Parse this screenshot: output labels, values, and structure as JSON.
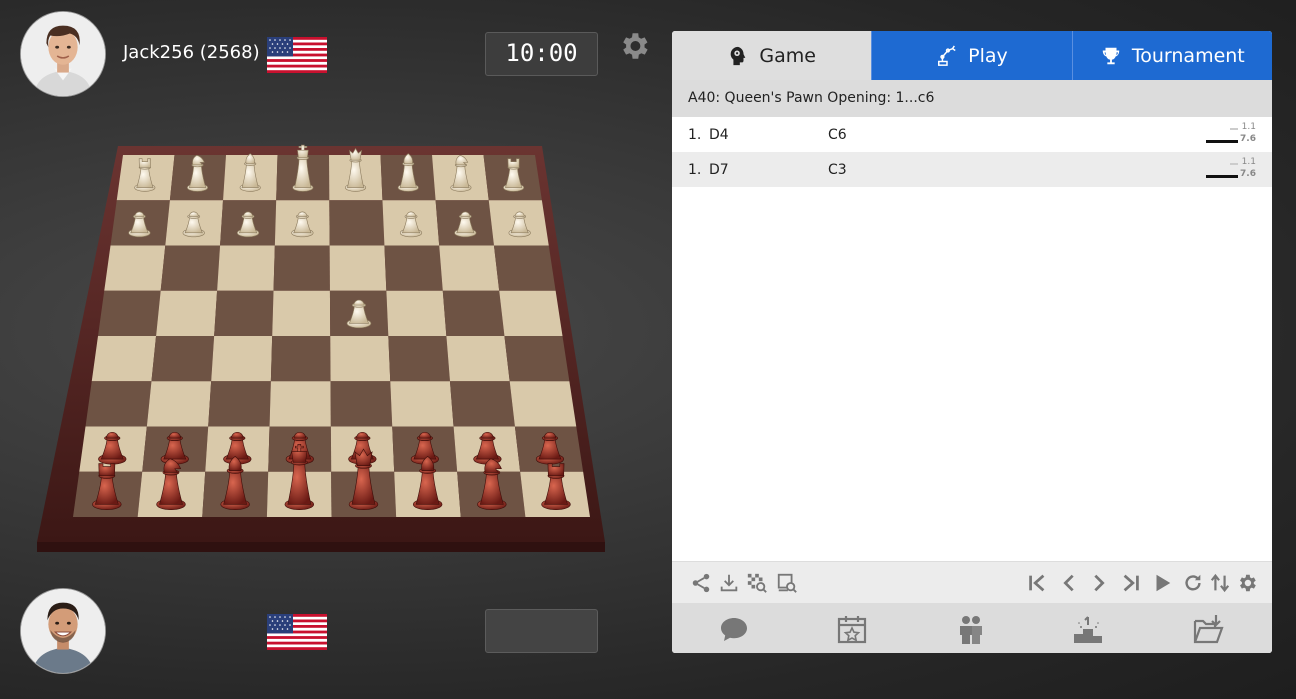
{
  "top_player": {
    "name": "Jack256 (2568)",
    "clock": "10:00",
    "avatar_icon": "player-avatar-top",
    "flag_icon": "us-flag-icon"
  },
  "bottom_player": {
    "name": "",
    "clock": "",
    "avatar_icon": "player-avatar-bottom",
    "flag_icon": "us-flag-icon"
  },
  "settings_icon": "gear-icon",
  "board": {
    "white_pieces_top": true,
    "light_square": "#d9c9aa",
    "dark_square": "#6e5344",
    "frame_color": "#5a2a28",
    "white_piece_color": "#efe6d4",
    "red_piece_color": "#a5352a"
  },
  "panel": {
    "tabs": [
      {
        "label": "Game",
        "icon": "brain-head-icon",
        "active": true
      },
      {
        "label": "Play",
        "icon": "robot-arm-icon",
        "active": false
      },
      {
        "label": "Tournament",
        "icon": "trophy-icon",
        "active": false
      }
    ],
    "opening": "A40: Queen's Pawn Opening: 1...c6",
    "moves": [
      {
        "num": "1.",
        "white": "D4",
        "black": "C6",
        "eval_top": "1.1",
        "eval_bottom": "7.6"
      },
      {
        "num": "1.",
        "white": "D7",
        "black": "C3",
        "eval_top": "1.1",
        "eval_bottom": "7.6"
      }
    ],
    "toolbar_icons": [
      "share-icon",
      "download-icon",
      "board-search-icon",
      "analysis-search-icon",
      "first-move-icon",
      "prev-move-icon",
      "next-move-icon",
      "last-move-icon",
      "play-icon",
      "refresh-icon",
      "flip-board-icon",
      "settings-icon"
    ],
    "bottom_icons": [
      "chat-icon",
      "calendar-star-icon",
      "friends-icon",
      "podium-icon",
      "open-folder-icon"
    ]
  },
  "colors": {
    "accent_blue": "#1e6ad2",
    "tab_active_bg": "#dedede",
    "icon_gray": "#777777"
  }
}
